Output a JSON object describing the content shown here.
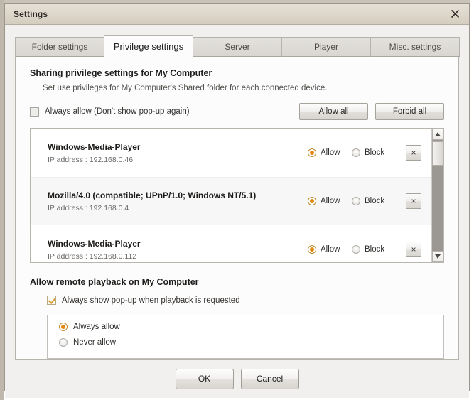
{
  "window": {
    "title": "Settings",
    "close_icon": "close-icon"
  },
  "tabs": [
    {
      "label": "Folder settings",
      "active": false
    },
    {
      "label": "Privilege settings",
      "active": true
    },
    {
      "label": "Server",
      "active": false
    },
    {
      "label": "Player",
      "active": false
    },
    {
      "label": "Misc. settings",
      "active": false
    }
  ],
  "sharing": {
    "title": "Sharing privilege settings for My Computer",
    "subtitle": "Set use privileges for My Computer's Shared folder for each connected device.",
    "always_allow_label": "Always allow (Don't show pop-up again)",
    "always_allow_checked": false,
    "allow_all_label": "Allow all",
    "forbid_all_label": "Forbid all"
  },
  "devices": {
    "allow_label": "Allow",
    "block_label": "Block",
    "remove_label": "×",
    "ip_prefix": "IP address : ",
    "rows": [
      {
        "name": "Windows-Media-Player",
        "ip": "IP address : 192.168.0.46",
        "permission": "allow"
      },
      {
        "name": "Mozilla/4.0 (compatible; UPnP/1.0; Windows NT/5.1)",
        "ip": "IP address : 192.168.0.4",
        "permission": "allow"
      },
      {
        "name": "Windows-Media-Player",
        "ip": "IP address : 192.168.0.112",
        "permission": "allow"
      }
    ]
  },
  "remote_playback": {
    "title": "Allow remote playback on My Computer",
    "popup_label": "Always show pop-up when playback is requested",
    "popup_checked": true,
    "options": [
      {
        "label": "Always allow",
        "selected": true
      },
      {
        "label": "Never allow",
        "selected": false
      }
    ]
  },
  "footer": {
    "ok_label": "OK",
    "cancel_label": "Cancel"
  },
  "colors": {
    "accent": "#e8870f",
    "titlebar": "#ddd6ca",
    "panel": "#fcfcfc"
  }
}
